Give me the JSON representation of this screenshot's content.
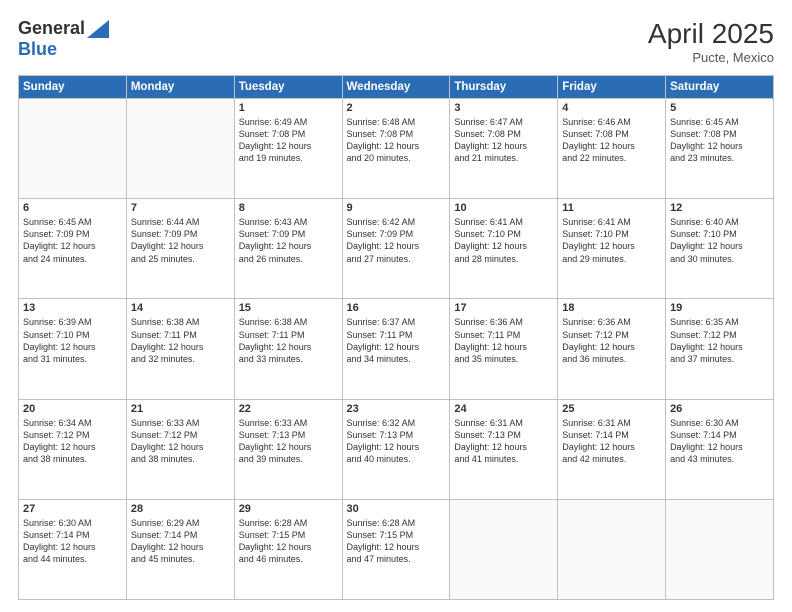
{
  "header": {
    "logo_general": "General",
    "logo_blue": "Blue",
    "month_year": "April 2025",
    "location": "Pucte, Mexico"
  },
  "days_of_week": [
    "Sunday",
    "Monday",
    "Tuesday",
    "Wednesday",
    "Thursday",
    "Friday",
    "Saturday"
  ],
  "weeks": [
    [
      {
        "day": "",
        "detail": ""
      },
      {
        "day": "",
        "detail": ""
      },
      {
        "day": "1",
        "detail": "Sunrise: 6:49 AM\nSunset: 7:08 PM\nDaylight: 12 hours\nand 19 minutes."
      },
      {
        "day": "2",
        "detail": "Sunrise: 6:48 AM\nSunset: 7:08 PM\nDaylight: 12 hours\nand 20 minutes."
      },
      {
        "day": "3",
        "detail": "Sunrise: 6:47 AM\nSunset: 7:08 PM\nDaylight: 12 hours\nand 21 minutes."
      },
      {
        "day": "4",
        "detail": "Sunrise: 6:46 AM\nSunset: 7:08 PM\nDaylight: 12 hours\nand 22 minutes."
      },
      {
        "day": "5",
        "detail": "Sunrise: 6:45 AM\nSunset: 7:08 PM\nDaylight: 12 hours\nand 23 minutes."
      }
    ],
    [
      {
        "day": "6",
        "detail": "Sunrise: 6:45 AM\nSunset: 7:09 PM\nDaylight: 12 hours\nand 24 minutes."
      },
      {
        "day": "7",
        "detail": "Sunrise: 6:44 AM\nSunset: 7:09 PM\nDaylight: 12 hours\nand 25 minutes."
      },
      {
        "day": "8",
        "detail": "Sunrise: 6:43 AM\nSunset: 7:09 PM\nDaylight: 12 hours\nand 26 minutes."
      },
      {
        "day": "9",
        "detail": "Sunrise: 6:42 AM\nSunset: 7:09 PM\nDaylight: 12 hours\nand 27 minutes."
      },
      {
        "day": "10",
        "detail": "Sunrise: 6:41 AM\nSunset: 7:10 PM\nDaylight: 12 hours\nand 28 minutes."
      },
      {
        "day": "11",
        "detail": "Sunrise: 6:41 AM\nSunset: 7:10 PM\nDaylight: 12 hours\nand 29 minutes."
      },
      {
        "day": "12",
        "detail": "Sunrise: 6:40 AM\nSunset: 7:10 PM\nDaylight: 12 hours\nand 30 minutes."
      }
    ],
    [
      {
        "day": "13",
        "detail": "Sunrise: 6:39 AM\nSunset: 7:10 PM\nDaylight: 12 hours\nand 31 minutes."
      },
      {
        "day": "14",
        "detail": "Sunrise: 6:38 AM\nSunset: 7:11 PM\nDaylight: 12 hours\nand 32 minutes."
      },
      {
        "day": "15",
        "detail": "Sunrise: 6:38 AM\nSunset: 7:11 PM\nDaylight: 12 hours\nand 33 minutes."
      },
      {
        "day": "16",
        "detail": "Sunrise: 6:37 AM\nSunset: 7:11 PM\nDaylight: 12 hours\nand 34 minutes."
      },
      {
        "day": "17",
        "detail": "Sunrise: 6:36 AM\nSunset: 7:11 PM\nDaylight: 12 hours\nand 35 minutes."
      },
      {
        "day": "18",
        "detail": "Sunrise: 6:36 AM\nSunset: 7:12 PM\nDaylight: 12 hours\nand 36 minutes."
      },
      {
        "day": "19",
        "detail": "Sunrise: 6:35 AM\nSunset: 7:12 PM\nDaylight: 12 hours\nand 37 minutes."
      }
    ],
    [
      {
        "day": "20",
        "detail": "Sunrise: 6:34 AM\nSunset: 7:12 PM\nDaylight: 12 hours\nand 38 minutes."
      },
      {
        "day": "21",
        "detail": "Sunrise: 6:33 AM\nSunset: 7:12 PM\nDaylight: 12 hours\nand 38 minutes."
      },
      {
        "day": "22",
        "detail": "Sunrise: 6:33 AM\nSunset: 7:13 PM\nDaylight: 12 hours\nand 39 minutes."
      },
      {
        "day": "23",
        "detail": "Sunrise: 6:32 AM\nSunset: 7:13 PM\nDaylight: 12 hours\nand 40 minutes."
      },
      {
        "day": "24",
        "detail": "Sunrise: 6:31 AM\nSunset: 7:13 PM\nDaylight: 12 hours\nand 41 minutes."
      },
      {
        "day": "25",
        "detail": "Sunrise: 6:31 AM\nSunset: 7:14 PM\nDaylight: 12 hours\nand 42 minutes."
      },
      {
        "day": "26",
        "detail": "Sunrise: 6:30 AM\nSunset: 7:14 PM\nDaylight: 12 hours\nand 43 minutes."
      }
    ],
    [
      {
        "day": "27",
        "detail": "Sunrise: 6:30 AM\nSunset: 7:14 PM\nDaylight: 12 hours\nand 44 minutes."
      },
      {
        "day": "28",
        "detail": "Sunrise: 6:29 AM\nSunset: 7:14 PM\nDaylight: 12 hours\nand 45 minutes."
      },
      {
        "day": "29",
        "detail": "Sunrise: 6:28 AM\nSunset: 7:15 PM\nDaylight: 12 hours\nand 46 minutes."
      },
      {
        "day": "30",
        "detail": "Sunrise: 6:28 AM\nSunset: 7:15 PM\nDaylight: 12 hours\nand 47 minutes."
      },
      {
        "day": "",
        "detail": ""
      },
      {
        "day": "",
        "detail": ""
      },
      {
        "day": "",
        "detail": ""
      }
    ]
  ]
}
